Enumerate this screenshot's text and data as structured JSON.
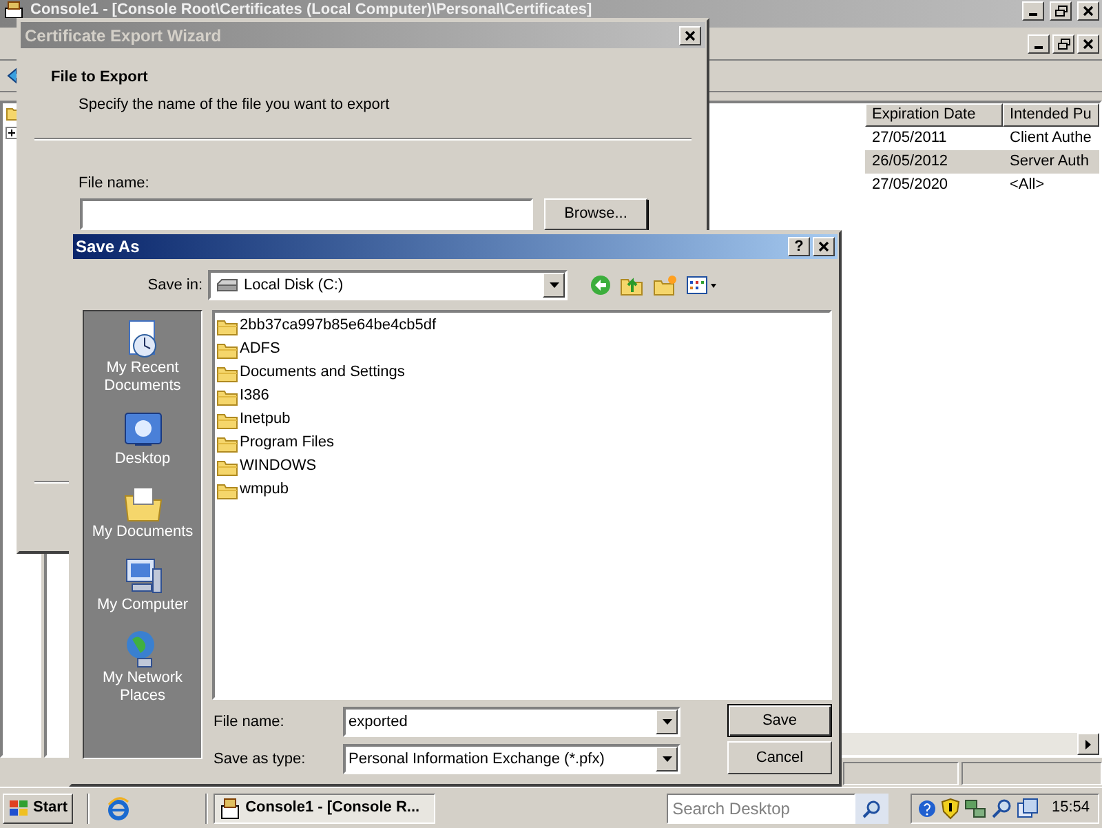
{
  "console": {
    "title": "Console1 - [Console Root\\Certificates (Local Computer)\\Personal\\Certificates]",
    "columns": [
      {
        "label": "Expiration Date"
      },
      {
        "label": "Intended Pu"
      }
    ],
    "rows": [
      {
        "cells": [
          "27/05/2011",
          "Client Authe"
        ],
        "selected": false
      },
      {
        "cells": [
          "26/05/2012",
          "Server Auth"
        ],
        "selected": true
      },
      {
        "cells": [
          "27/05/2020",
          "<All>"
        ],
        "selected": false
      }
    ]
  },
  "wizard": {
    "title": "Certificate Export Wizard",
    "heading": "File to Export",
    "subtitle": "Specify the name of the file you want to export",
    "file_label": "File name:",
    "browse": "Browse..."
  },
  "save_as": {
    "title": "Save As",
    "help": "?",
    "save_in_label": "Save in:",
    "save_in_value": "Local Disk (C:)",
    "places": [
      {
        "label": "My Recent Documents",
        "kind": "recent"
      },
      {
        "label": "Desktop",
        "kind": "desktop"
      },
      {
        "label": "My Documents",
        "kind": "documents"
      },
      {
        "label": "My Computer",
        "kind": "computer"
      },
      {
        "label": "My Network Places",
        "kind": "network"
      }
    ],
    "files": [
      {
        "name": "2bb37ca997b85e64be4cb5df"
      },
      {
        "name": "ADFS"
      },
      {
        "name": "Documents and Settings"
      },
      {
        "name": "I386"
      },
      {
        "name": "Inetpub"
      },
      {
        "name": "Program Files"
      },
      {
        "name": "WINDOWS"
      },
      {
        "name": "wmpub"
      }
    ],
    "file_name_label": "File name:",
    "file_name_value": "exported",
    "type_label": "Save as type:",
    "type_value": "Personal Information Exchange (*.pfx)",
    "save": "Save",
    "cancel": "Cancel"
  },
  "taskbar": {
    "start": "Start",
    "task": "Console1 - [Console R...",
    "search_placeholder": "Search Desktop",
    "clock": "15:54"
  }
}
